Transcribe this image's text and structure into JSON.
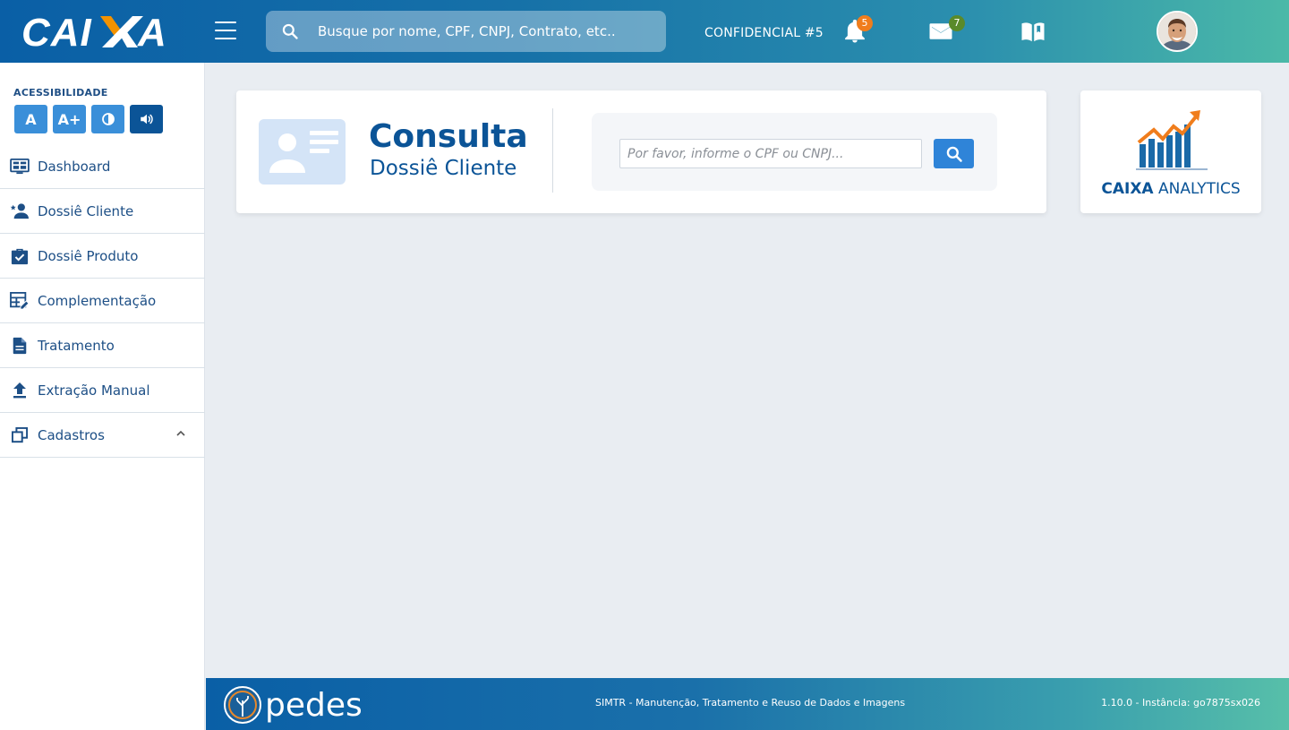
{
  "header": {
    "logo_text": "CAIXA",
    "search_placeholder": "Busque por nome, CPF, CNPJ, Contrato, etc..",
    "confidencial": "CONFIDENCIAL #5",
    "notifications_count": "5",
    "messages_count": "7",
    "colors": {
      "notif_badge": "#f07d1c",
      "msg_badge": "#5a8a2a"
    }
  },
  "sidebar": {
    "accessibility_title": "ACESSIBILIDADE",
    "acc_buttons": [
      "A",
      "A+"
    ],
    "items": [
      {
        "label": "Dashboard",
        "icon": "dashboard-icon"
      },
      {
        "label": "Dossiê Cliente",
        "icon": "person-add-icon"
      },
      {
        "label": "Dossiê Produto",
        "icon": "briefcase-check-icon"
      },
      {
        "label": "Complementação",
        "icon": "table-edit-icon"
      },
      {
        "label": "Tratamento",
        "icon": "document-icon"
      },
      {
        "label": "Extração Manual",
        "icon": "upload-icon"
      },
      {
        "label": "Cadastros",
        "icon": "copy-icon"
      }
    ]
  },
  "main": {
    "title": "Consulta",
    "subtitle": "Dossiê Cliente",
    "cpf_placeholder": "Por favor, informe o CPF ou CNPJ..."
  },
  "analytics": {
    "brand": "CAIXA",
    "label": "ANALYTICS"
  },
  "footer": {
    "logo_text": "pedes",
    "center": "SIMTR - Manutenção, Tratamento e Reuso de Dados e Imagens",
    "right": "1.10.0 - Instância: go7875sx026"
  }
}
